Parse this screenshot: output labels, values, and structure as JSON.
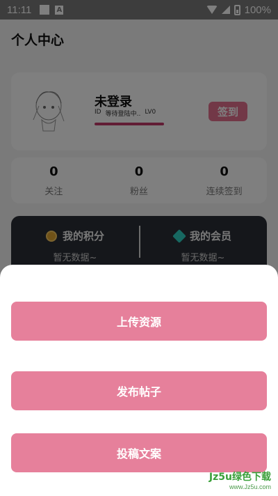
{
  "status_bar": {
    "time": "11:11",
    "notification_icon_letter": "A",
    "battery_percent": "100%"
  },
  "header": {
    "title": "个人中心"
  },
  "profile": {
    "username": "未登录",
    "id_label": "ID",
    "id_value": "等待登陆中..",
    "level": "LV0",
    "signin_label": "签到"
  },
  "stats": [
    {
      "value": "0",
      "label": "关注"
    },
    {
      "value": "0",
      "label": "粉丝"
    },
    {
      "value": "0",
      "label": "连续签到"
    }
  ],
  "vip": {
    "points_title": "我的积分",
    "points_sub": "暂无数据~",
    "member_title": "我的会员",
    "member_sub": "暂无数据~"
  },
  "sheet": {
    "actions": [
      "上传资源",
      "发布帖子",
      "投稿文案"
    ]
  },
  "watermark": {
    "brand": "Jz5u绿色下载",
    "url": "www.Jz5u.com"
  },
  "colors": {
    "accent": "#e6809b",
    "signin": "#e5708f",
    "progress": "#c23b6a",
    "vip_bg": "#2b2f36"
  }
}
